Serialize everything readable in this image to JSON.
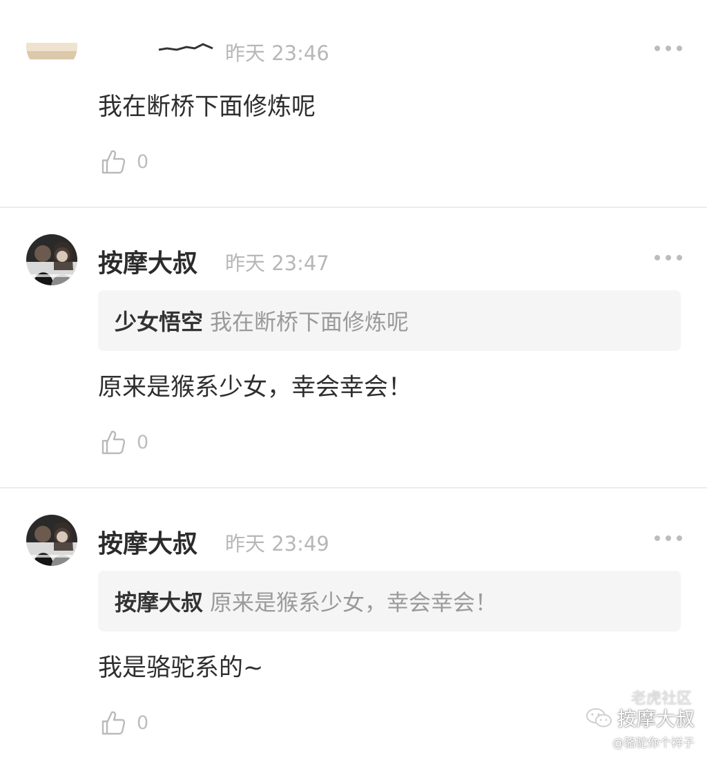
{
  "comments": [
    {
      "username": "",
      "time": "昨天 23:46",
      "quote": null,
      "text": "我在断桥下面修炼呢",
      "likes": "0"
    },
    {
      "username": "按摩大叔",
      "time": "昨天 23:47",
      "quote": {
        "name": "少女悟空",
        "text": "我在断桥下面修炼呢"
      },
      "text": "原来是猴系少女，幸会幸会！",
      "likes": "0"
    },
    {
      "username": "按摩大叔",
      "time": "昨天 23:49",
      "quote": {
        "name": "按摩大叔",
        "text": "原来是猴系少女，幸会幸会！"
      },
      "text": "我是骆驼系的~",
      "likes": "0"
    }
  ],
  "icons": {
    "like": "thumbs-up-icon",
    "more": "more-dots-icon",
    "wechat": "wechat-icon"
  },
  "colors": {
    "divider": "#ececec",
    "quote_bg": "#f5f5f6",
    "muted": "#b7b7b7"
  },
  "watermark": {
    "top": "老虎社区",
    "name": "按摩大叔",
    "handle": "@骆驼你个祥子"
  }
}
